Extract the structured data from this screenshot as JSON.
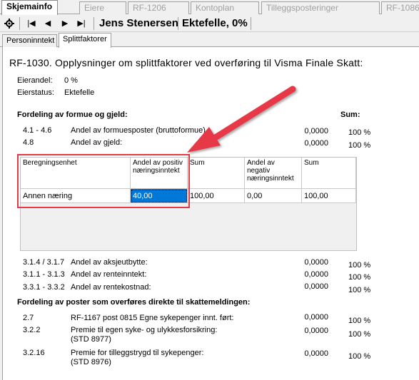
{
  "top_tabs": [
    "Skjemainfo",
    "Eiere",
    "RF-1206",
    "Kontoplan",
    "Tilleggsposteringer",
    "RF-1086"
  ],
  "toolbar": {
    "icons": [
      "gear-icon",
      "first-icon",
      "prev-icon",
      "next-icon",
      "last-icon"
    ],
    "first": "|◀",
    "prev": "◀",
    "next": "▶",
    "last": "▶|",
    "owner_name": "Jens Stenersen",
    "owner_status": "Ektefelle, 0%"
  },
  "sub_tabs": [
    "Personinntekt",
    "Splittfaktorer"
  ],
  "panel": {
    "title": "RF-1030. Opplysninger om splittfaktorer ved overføring til Visma Finale Skatt:",
    "eierandel_label": "Eierandel:",
    "eierandel_value": "0 %",
    "eierstatus_label": "Eierstatus:",
    "eierstatus_value": "Ektefelle",
    "section1_heading": "Fordeling av formue og gjeld:",
    "sum_label": "Sum:",
    "rows1": [
      {
        "code": "4.1 - 4.6",
        "label": "Andel av formuesposter (bruttoformue)",
        "value": "0,0000",
        "pct": "100 %"
      },
      {
        "code": "4.8",
        "label": "Andel av gjeld:",
        "value": "0,0000",
        "pct": "100 %"
      }
    ],
    "grid": {
      "headers": [
        "Beregningsenhet",
        "Andel av positiv næringsinntekt",
        "Sum",
        "Andel av negativ næringsinntekt",
        "Sum"
      ],
      "row": [
        "Annen næring",
        "40,00",
        "100,00",
        "0,00",
        "100,00"
      ]
    },
    "rows2": [
      {
        "code": "3.1.4 / 3.1.7",
        "label": "Andel av aksjeutbytte:",
        "value": "0,0000",
        "pct": "100 %"
      },
      {
        "code": "3.1.1 - 3.1.3",
        "label": "Andel av renteinntekt:",
        "value": "0,0000",
        "pct": "100 %"
      },
      {
        "code": "3.3.1 - 3.3.2",
        "label": "Andel av rentekostnad:",
        "value": "0,0000",
        "pct": "100 %"
      }
    ],
    "section2_heading": "Fordeling av poster som overføres direkte til skattemeldingen:",
    "rows3": [
      {
        "code": "2.7",
        "label1": "RF-1167 post 0815 Egne sykepenger innt. ført:",
        "label2": "",
        "value": "0,0000",
        "pct": "100 %"
      },
      {
        "code": "3.2.2",
        "label1": "Premie til egen syke- og ulykkesforsikring:",
        "label2": "(STD 8977)",
        "value": "0,0000",
        "pct": "100 %"
      },
      {
        "code": "3.2.16",
        "label1": "Premie for tilleggstrygd til sykepenger:",
        "label2": "(STD 8976)",
        "value": "0,0000",
        "pct": "100 %"
      }
    ]
  },
  "colors": {
    "selection": "#0078d7",
    "callout": "#e63946"
  }
}
